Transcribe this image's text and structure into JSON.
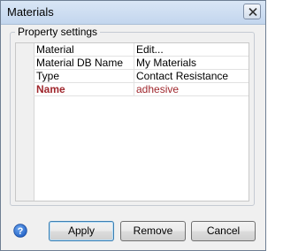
{
  "window": {
    "title": "Materials"
  },
  "group": {
    "label": "Property settings"
  },
  "properties": [
    {
      "name": "Material",
      "value": "Edit...",
      "highlight": false
    },
    {
      "name": "Material DB Name",
      "value": "My Materials",
      "highlight": false
    },
    {
      "name": "Type",
      "value": "Contact Resistance",
      "highlight": false
    },
    {
      "name": "Name",
      "value": "adhesive",
      "highlight": true
    }
  ],
  "buttons": {
    "apply": "Apply",
    "remove": "Remove",
    "cancel": "Cancel"
  },
  "icons": {
    "close": "close-icon",
    "help": "help-icon"
  },
  "colors": {
    "highlight_text": "#a0282e",
    "default_button_border": "#3c7fb1"
  }
}
